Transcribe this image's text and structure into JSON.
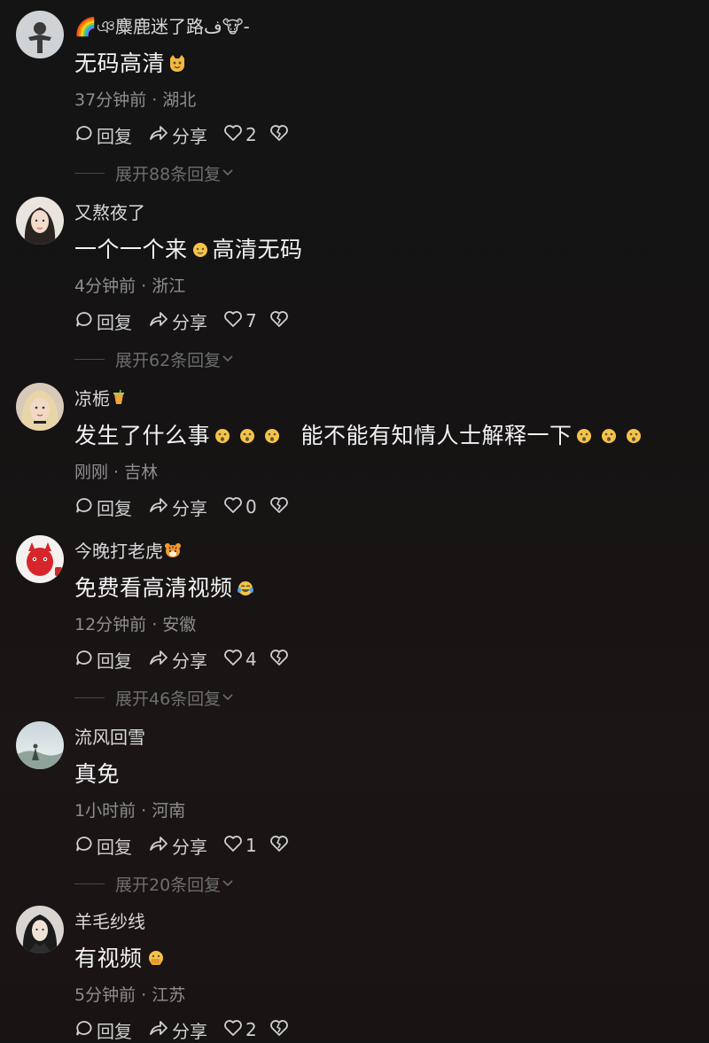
{
  "comments": [
    {
      "username": "🌈ঞ麋鹿迷了路ف🐮-",
      "text_parts": [
        "无码高清"
      ],
      "time_location": "37分钟前 · 湖北",
      "reply_label": "回复",
      "share_label": "分享",
      "like_count": "2",
      "expand_label": "展开88条回复"
    },
    {
      "username": "又熬夜了",
      "text_parts": [
        "一个一个来",
        "高清无码"
      ],
      "time_location": "4分钟前 · 浙江",
      "reply_label": "回复",
      "share_label": "分享",
      "like_count": "7",
      "expand_label": "展开62条回复"
    },
    {
      "username": "凉栀",
      "text_parts": [
        "发生了什么事",
        "能不能有知情人士解释一下"
      ],
      "time_location": "刚刚 · 吉林",
      "reply_label": "回复",
      "share_label": "分享",
      "like_count": "0"
    },
    {
      "username": "今晚打老虎",
      "text_parts": [
        "免费看高清视频"
      ],
      "time_location": "12分钟前 · 安徽",
      "reply_label": "回复",
      "share_label": "分享",
      "like_count": "4",
      "expand_label": "展开46条回复"
    },
    {
      "username": "流风回雪",
      "text_parts": [
        "真免"
      ],
      "time_location": "1小时前 · 河南",
      "reply_label": "回复",
      "share_label": "分享",
      "like_count": "1",
      "expand_label": "展开20条回复"
    },
    {
      "username": "羊毛纱线",
      "text_parts": [
        "有视频"
      ],
      "time_location": "5分钟前 · 江苏",
      "reply_label": "回复",
      "share_label": "分享",
      "like_count": "2"
    }
  ],
  "icons": {
    "reply": "speech-bubble-icon",
    "share": "share-arrow-icon",
    "like": "heart-icon",
    "dislike": "broken-heart-icon",
    "expand": "chevron-down-icon"
  },
  "colors": {
    "background": "#151313",
    "text_primary": "#f2f2f2",
    "text_secondary": "#8e8e8e",
    "text_muted": "#6e6e6e"
  }
}
